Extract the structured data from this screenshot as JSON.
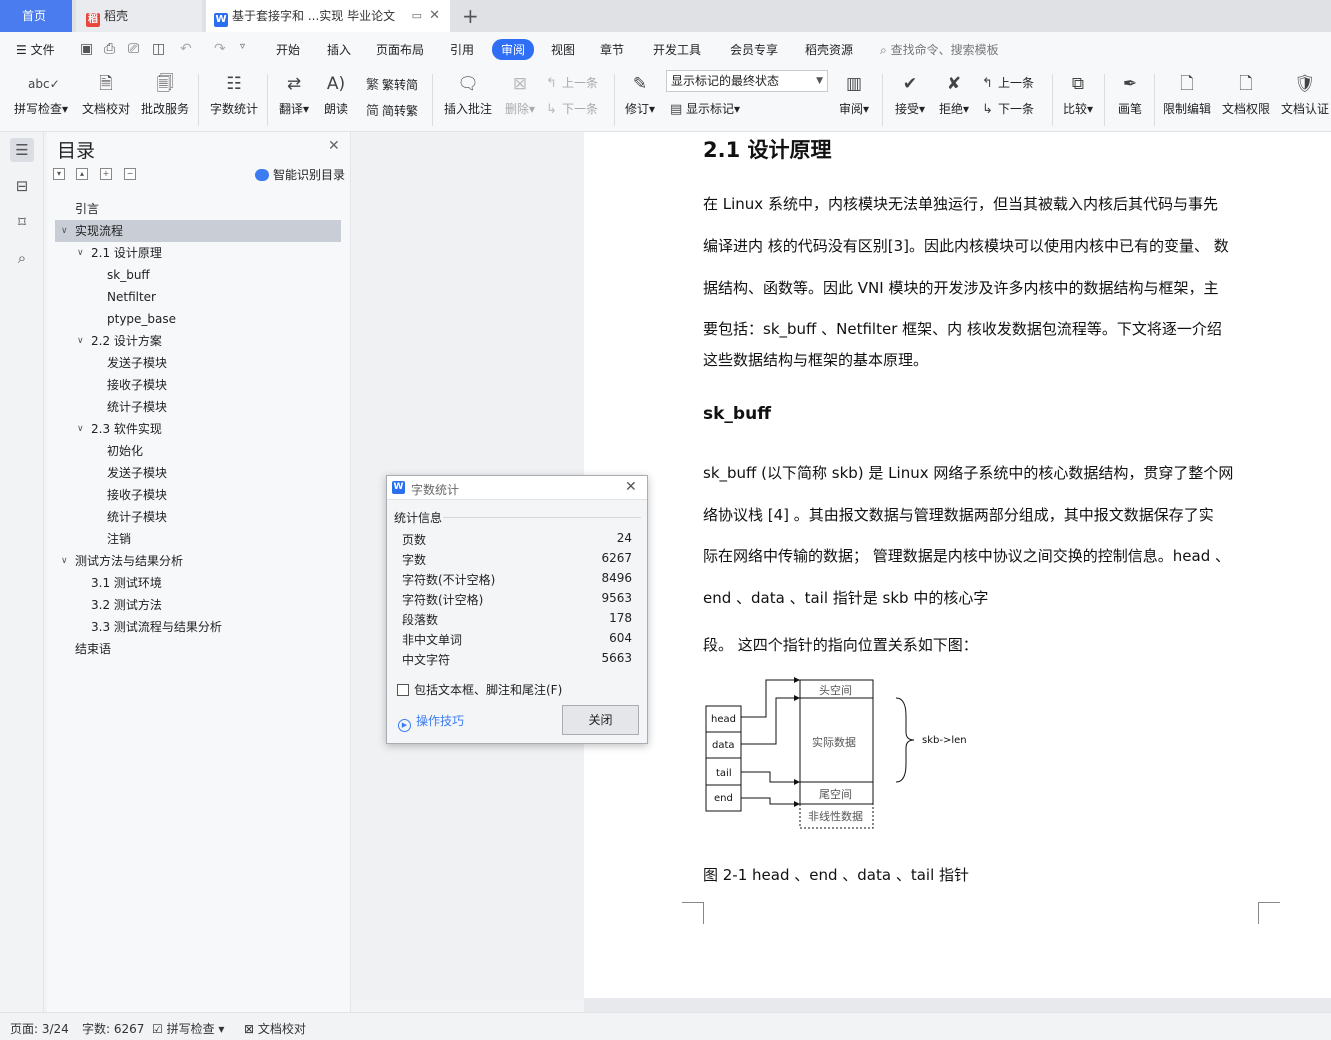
{
  "tabs": {
    "home": "首页",
    "app": "稻壳",
    "doc": "基于套接字和 ...实现 毕业论文",
    "app_icon": "daoke-icon",
    "doc_icon": "wps-writer-icon"
  },
  "menubar": {
    "file": "文件",
    "items": [
      "开始",
      "插入",
      "页面布局",
      "引用",
      "审阅",
      "视图",
      "章节",
      "开发工具",
      "会员专享",
      "稻壳资源"
    ],
    "active": "审阅",
    "search": "查找命令、搜索模板"
  },
  "ribbon": {
    "spell_check": "拼写检查",
    "doc_proofread": "文档校对",
    "batch_service": "批改服务",
    "word_count": "字数统计",
    "translate": "翻译",
    "read_aloud": "朗读",
    "trad_to_simp": "繁转简",
    "simp_to_trad": "简转繁",
    "insert_comment": "插入批注",
    "delete": "删除",
    "prev_comment": "上一条",
    "next_comment": "下一条",
    "revise": "修订",
    "markup_state": "显示标记的最终状态",
    "show_markup": "显示标记",
    "review": "审阅",
    "accept": "接受",
    "reject": "拒绝",
    "prev_change": "上一条",
    "next_change": "下一条",
    "compare": "比较",
    "pen": "画笔",
    "restrict_edit": "限制编辑",
    "doc_permission": "文档权限",
    "doc_certify": "文档认证"
  },
  "toc": {
    "title": "目录",
    "smart_detect": "智能识别目录",
    "items": [
      {
        "label": "引言",
        "level": 1,
        "arrow": false
      },
      {
        "label": "实现流程",
        "level": 1,
        "arrow": true,
        "selected": true
      },
      {
        "label": "2.1 设计原理",
        "level": 2,
        "arrow": true
      },
      {
        "label": "sk_buff",
        "level": 3,
        "arrow": false
      },
      {
        "label": "Netfilter",
        "level": 3,
        "arrow": false
      },
      {
        "label": "ptype_base",
        "level": 3,
        "arrow": false
      },
      {
        "label": "2.2 设计方案",
        "level": 2,
        "arrow": true
      },
      {
        "label": "发送子模块",
        "level": 3,
        "arrow": false
      },
      {
        "label": "接收子模块",
        "level": 3,
        "arrow": false
      },
      {
        "label": "统计子模块",
        "level": 3,
        "arrow": false
      },
      {
        "label": "2.3 软件实现",
        "level": 2,
        "arrow": true
      },
      {
        "label": "初始化",
        "level": 3,
        "arrow": false
      },
      {
        "label": "发送子模块",
        "level": 3,
        "arrow": false
      },
      {
        "label": "接收子模块",
        "level": 3,
        "arrow": false
      },
      {
        "label": "统计子模块",
        "level": 3,
        "arrow": false
      },
      {
        "label": "注销",
        "level": 3,
        "arrow": false
      },
      {
        "label": "测试方法与结果分析",
        "level": 1,
        "arrow": true
      },
      {
        "label": "3.1 测试环境",
        "level": 2,
        "arrow": false
      },
      {
        "label": "3.2 测试方法",
        "level": 2,
        "arrow": false
      },
      {
        "label": "3.3 测试流程与结果分析",
        "level": 2,
        "arrow": false
      },
      {
        "label": "结束语",
        "level": 1,
        "arrow": false
      }
    ]
  },
  "document": {
    "heading": "2.1 设计原理",
    "p1": [
      "在  Linux  系统中，内核模块无法单独运行，但当其被载入内核后其代码与事先",
      "编译进内  核的代码没有区别[3]。因此内核模块可以使用内核中已有的变量、 数",
      "据结构、函数等。因此  VNI  模块的开发涉及许多内核中的数据结构与框架，主",
      "要包括：sk_buff  、Netfilter  框架、内  核收发数据包流程等。下文将逐一介绍",
      "这些数据结构与框架的基本原理。"
    ],
    "subheading": "sk_buff",
    "p2": [
      "sk_buff (以下简称  skb)  是  Linux  网络子系统中的核心数据结构，贯穿了整个网",
      "络协议栈  [4]  。其由报文数据与管理数据两部分组成，其中报文数据保存了实",
      "际在网络中传输的数据；  管理数据是内核中协议之间交换的控制信息。head  、",
      "end  、data  、tail  指针是  skb  中的核心字",
      "段。  这四个指针的指向位置关系如下图："
    ],
    "figure": {
      "pointers": [
        "head",
        "data",
        "tail",
        "end"
      ],
      "regions": [
        "头空间",
        "实际数据",
        "尾空间",
        "非线性数据"
      ],
      "len_label": "skb->len"
    },
    "caption": "图  2-1 head  、end  、data  、tail  指针"
  },
  "dialog": {
    "title": "字数统计",
    "section": "统计信息",
    "stats": [
      {
        "label": "页数",
        "value": "24"
      },
      {
        "label": "字数",
        "value": "6267"
      },
      {
        "label": "字符数(不计空格)",
        "value": "8496"
      },
      {
        "label": "字符数(计空格)",
        "value": "9563"
      },
      {
        "label": "段落数",
        "value": "178"
      },
      {
        "label": "非中文单词",
        "value": "604"
      },
      {
        "label": "中文字符",
        "value": "5663"
      }
    ],
    "include_check": "包括文本框、脚注和尾注(F)",
    "tips": "操作技巧",
    "close": "关闭"
  },
  "statusbar": {
    "page": "页面: 3/24",
    "words": "字数: 6267",
    "spell": "拼写检查",
    "proof": "文档校对"
  },
  "colors": {
    "accent": "#2f6ff5",
    "home_tab": "#4a7cf0"
  }
}
